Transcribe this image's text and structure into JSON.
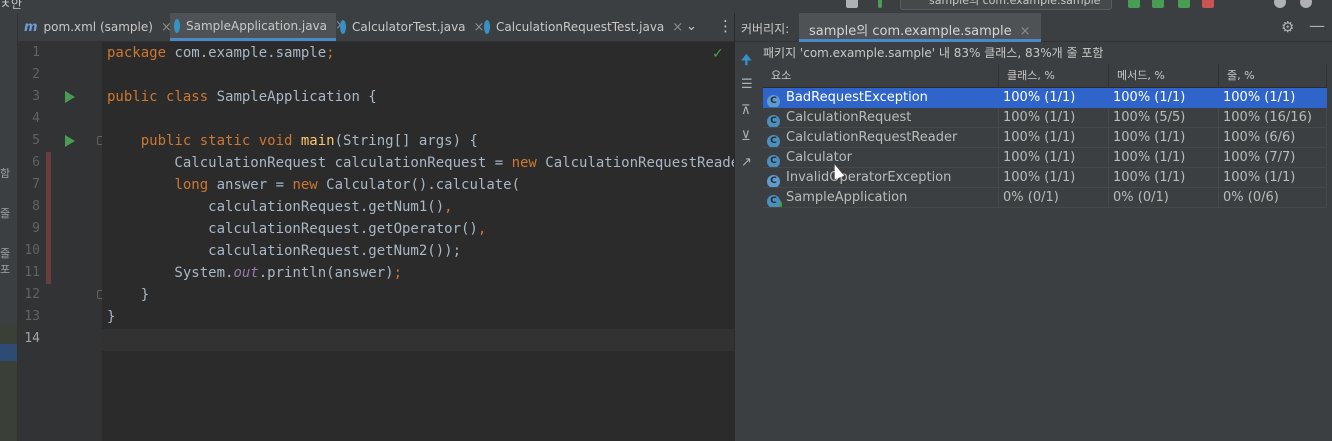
{
  "topbar": {
    "left_label": "ㅊ안",
    "run_config": "sample의 com.example.sample"
  },
  "left_strip": {
    "chars": [
      "함",
      "줄",
      "줄 포"
    ]
  },
  "editor": {
    "tabs": [
      {
        "label": "pom.xml (sample)",
        "icon": "maven-icon",
        "active": false
      },
      {
        "label": "SampleApplication.java",
        "icon": "java-class-icon",
        "active": true
      },
      {
        "label": "CalculatorTest.java",
        "icon": "java-class-icon",
        "active": false
      },
      {
        "label": "CalculationRequestTest.java",
        "icon": "java-class-icon",
        "active": false
      }
    ],
    "close_glyph": "×",
    "overflow_glyph": "⋮",
    "line_numbers": [
      "1",
      "2",
      "3",
      "4",
      "5",
      "6",
      "7",
      "8",
      "9",
      "10",
      "11",
      "12",
      "13",
      "14"
    ],
    "current_line": "14",
    "code": {
      "l1_kw": "package",
      "l1_rest": " com.example.sample",
      "l1_semi": ";",
      "l3_kw": "public class",
      "l3_rest": " SampleApplication {",
      "l5_indent": "    ",
      "l5_kw": "public static void",
      "l5_fn": "main",
      "l5_rest": "(String[] args) {",
      "l6_a": "        CalculationRequest calculationRequest = ",
      "l6_kw": "new",
      "l6_b": " CalculationRequestReader",
      "l7_indent": "        ",
      "l7_kw": "long",
      "l7_a": " answer = ",
      "l7_kw2": "new",
      "l7_b": " Calculator().calculate(",
      "l8": "            calculationRequest.getNum1()",
      "l8_comma": ",",
      "l9": "            calculationRequest.getOperator()",
      "l9_comma": ",",
      "l10": "            calculationRequest.getNum2());",
      "l11_a": "        System.",
      "l11_st": "out",
      "l11_b": ".println(answer)",
      "l11_semi": ";",
      "l12": "    }",
      "l13": "}"
    }
  },
  "coverage": {
    "panel_label": "커버리지:",
    "tab_label": "sample의 com.example.sample",
    "summary": "패키지 'com.example.sample' 내 83% 클래스, 83%개 줄 포함",
    "columns": [
      "요소",
      "클래스, %",
      "메서드, %",
      "줄, %"
    ],
    "rows": [
      {
        "name": "BadRequestException",
        "cls": "100% (1/1)",
        "method": "100% (1/1)",
        "line": "100% (1/1)",
        "selected": true
      },
      {
        "name": "CalculationRequest",
        "cls": "100% (1/1)",
        "method": "100% (5/5)",
        "line": "100% (16/16)",
        "selected": false
      },
      {
        "name": "CalculationRequestReader",
        "cls": "100% (1/1)",
        "method": "100% (1/1)",
        "line": "100% (6/6)",
        "selected": false
      },
      {
        "name": "Calculator",
        "cls": "100% (1/1)",
        "method": "100% (1/1)",
        "line": "100% (7/7)",
        "selected": false
      },
      {
        "name": "InvalidOperatorException",
        "cls": "100% (1/1)",
        "method": "100% (1/1)",
        "line": "100% (1/1)",
        "selected": false
      },
      {
        "name": "SampleApplication",
        "cls": "0% (0/1)",
        "method": "0% (0/1)",
        "line": "0% (0/6)",
        "selected": false
      }
    ],
    "class_icon_letter": "C"
  },
  "colors": {
    "accent": "#4a88c7",
    "selection": "#2f65ca",
    "keyword": "#cc7832",
    "function": "#ffc66d",
    "run": "#499c54"
  }
}
